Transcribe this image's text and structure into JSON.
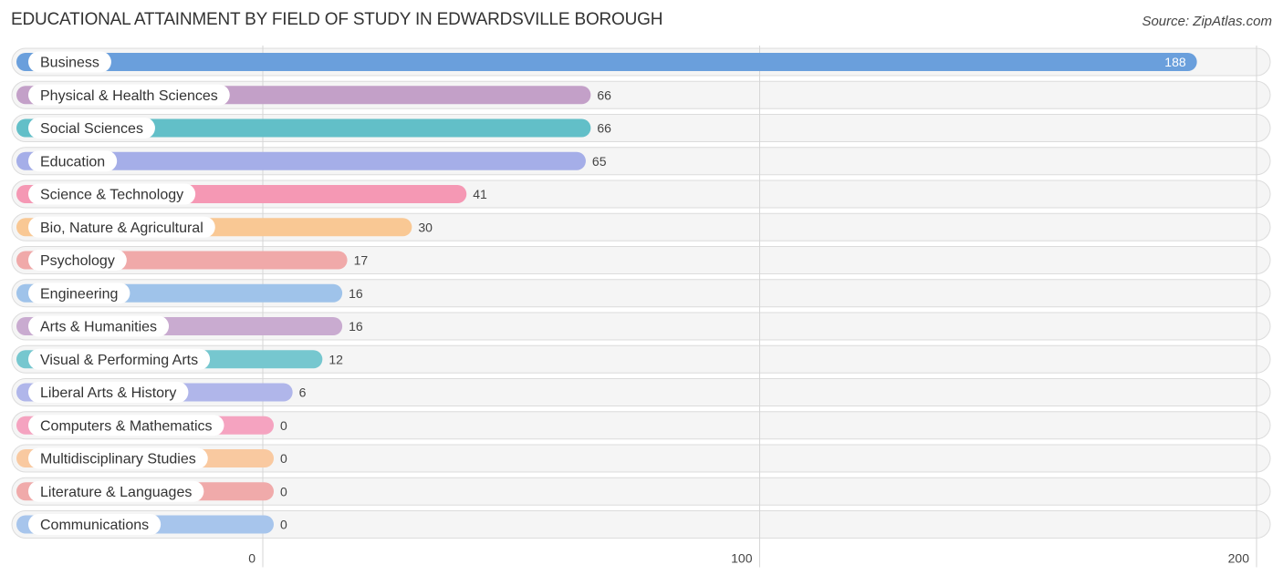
{
  "header": {
    "title": "EDUCATIONAL ATTAINMENT BY FIELD OF STUDY IN EDWARDSVILLE BOROUGH",
    "source": "Source: ZipAtlas.com"
  },
  "chart_data": {
    "type": "bar",
    "orientation": "horizontal",
    "title": "EDUCATIONAL ATTAINMENT BY FIELD OF STUDY IN EDWARDSVILLE BOROUGH",
    "xlabel": "",
    "ylabel": "",
    "xlim": [
      0,
      200
    ],
    "x_ticks": [
      0,
      100,
      200
    ],
    "x_tick_labels": [
      "0",
      "100",
      "200"
    ],
    "grid": true,
    "categories": [
      "Business",
      "Physical & Health Sciences",
      "Social Sciences",
      "Education",
      "Science & Technology",
      "Bio, Nature & Agricultural",
      "Psychology",
      "Engineering",
      "Arts & Humanities",
      "Visual & Performing Arts",
      "Liberal Arts & History",
      "Computers & Mathematics",
      "Multidisciplinary Studies",
      "Literature & Languages",
      "Communications"
    ],
    "values": [
      188,
      66,
      66,
      65,
      41,
      30,
      17,
      16,
      16,
      12,
      6,
      0,
      0,
      0,
      0
    ],
    "value_labels": [
      "188",
      "66",
      "66",
      "65",
      "41",
      "30",
      "17",
      "16",
      "16",
      "12",
      "6",
      "0",
      "0",
      "0",
      "0"
    ],
    "colors": [
      "#6a9fdc",
      "#c3a0c8",
      "#62bfc8",
      "#a5aee8",
      "#f598b4",
      "#f9c894",
      "#f0a9a9",
      "#9fc3ea",
      "#c9abd0",
      "#76c7cf",
      "#b0b6ea",
      "#f5a3c0",
      "#f9c9a0",
      "#f0aaaa",
      "#a7c5ec"
    ]
  }
}
